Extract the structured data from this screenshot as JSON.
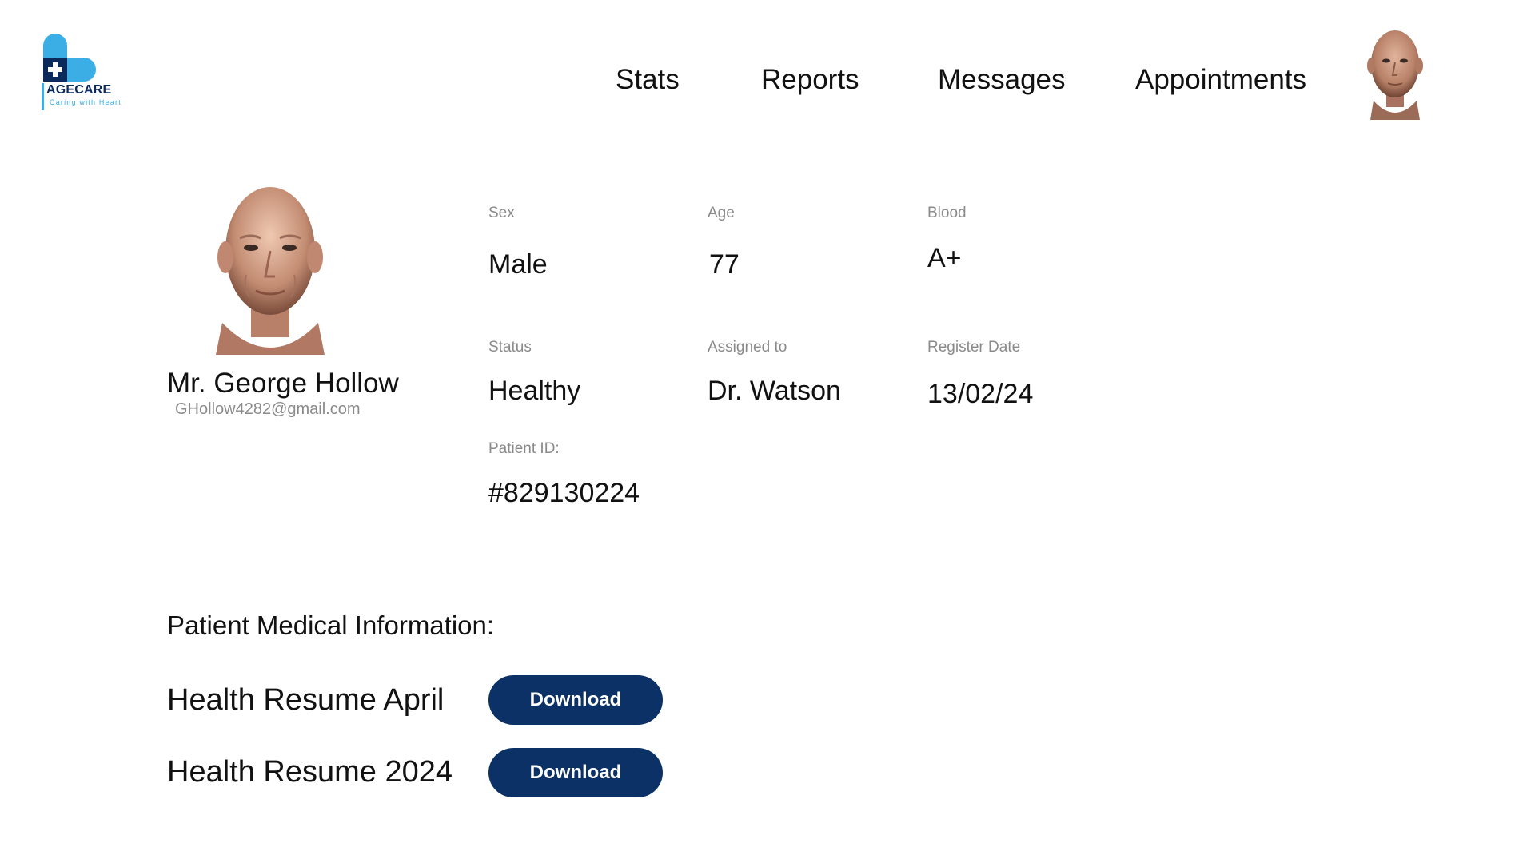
{
  "brand": {
    "name": "AGECARE",
    "tagline": "Caring with Heart",
    "accent": "#3aaee5",
    "dark": "#0b2a5b"
  },
  "nav": {
    "items": [
      {
        "label": "Stats"
      },
      {
        "label": "Reports"
      },
      {
        "label": "Messages"
      },
      {
        "label": "Appointments"
      }
    ]
  },
  "patient": {
    "name": "Mr. George Hollow",
    "email": "GHollow4282@gmail.com",
    "fields": {
      "sex": {
        "label": "Sex",
        "value": "Male"
      },
      "age": {
        "label": "Age",
        "value": "77"
      },
      "blood": {
        "label": "Blood",
        "value": "A+"
      },
      "status": {
        "label": "Status",
        "value": "Healthy"
      },
      "assigned": {
        "label": "Assigned to",
        "value": "Dr. Watson"
      },
      "register": {
        "label": "Register Date",
        "value": "13/02/24"
      },
      "patient_id": {
        "label": "Patient ID:",
        "value": "#829130224"
      }
    }
  },
  "medical": {
    "title": "Patient Medical Information:",
    "documents": [
      {
        "name": "Health Resume April",
        "action": "Download"
      },
      {
        "name": "Health Resume 2024",
        "action": "Download"
      }
    ]
  },
  "colors": {
    "button": "#0b3166",
    "label": "#8a8a8a"
  }
}
